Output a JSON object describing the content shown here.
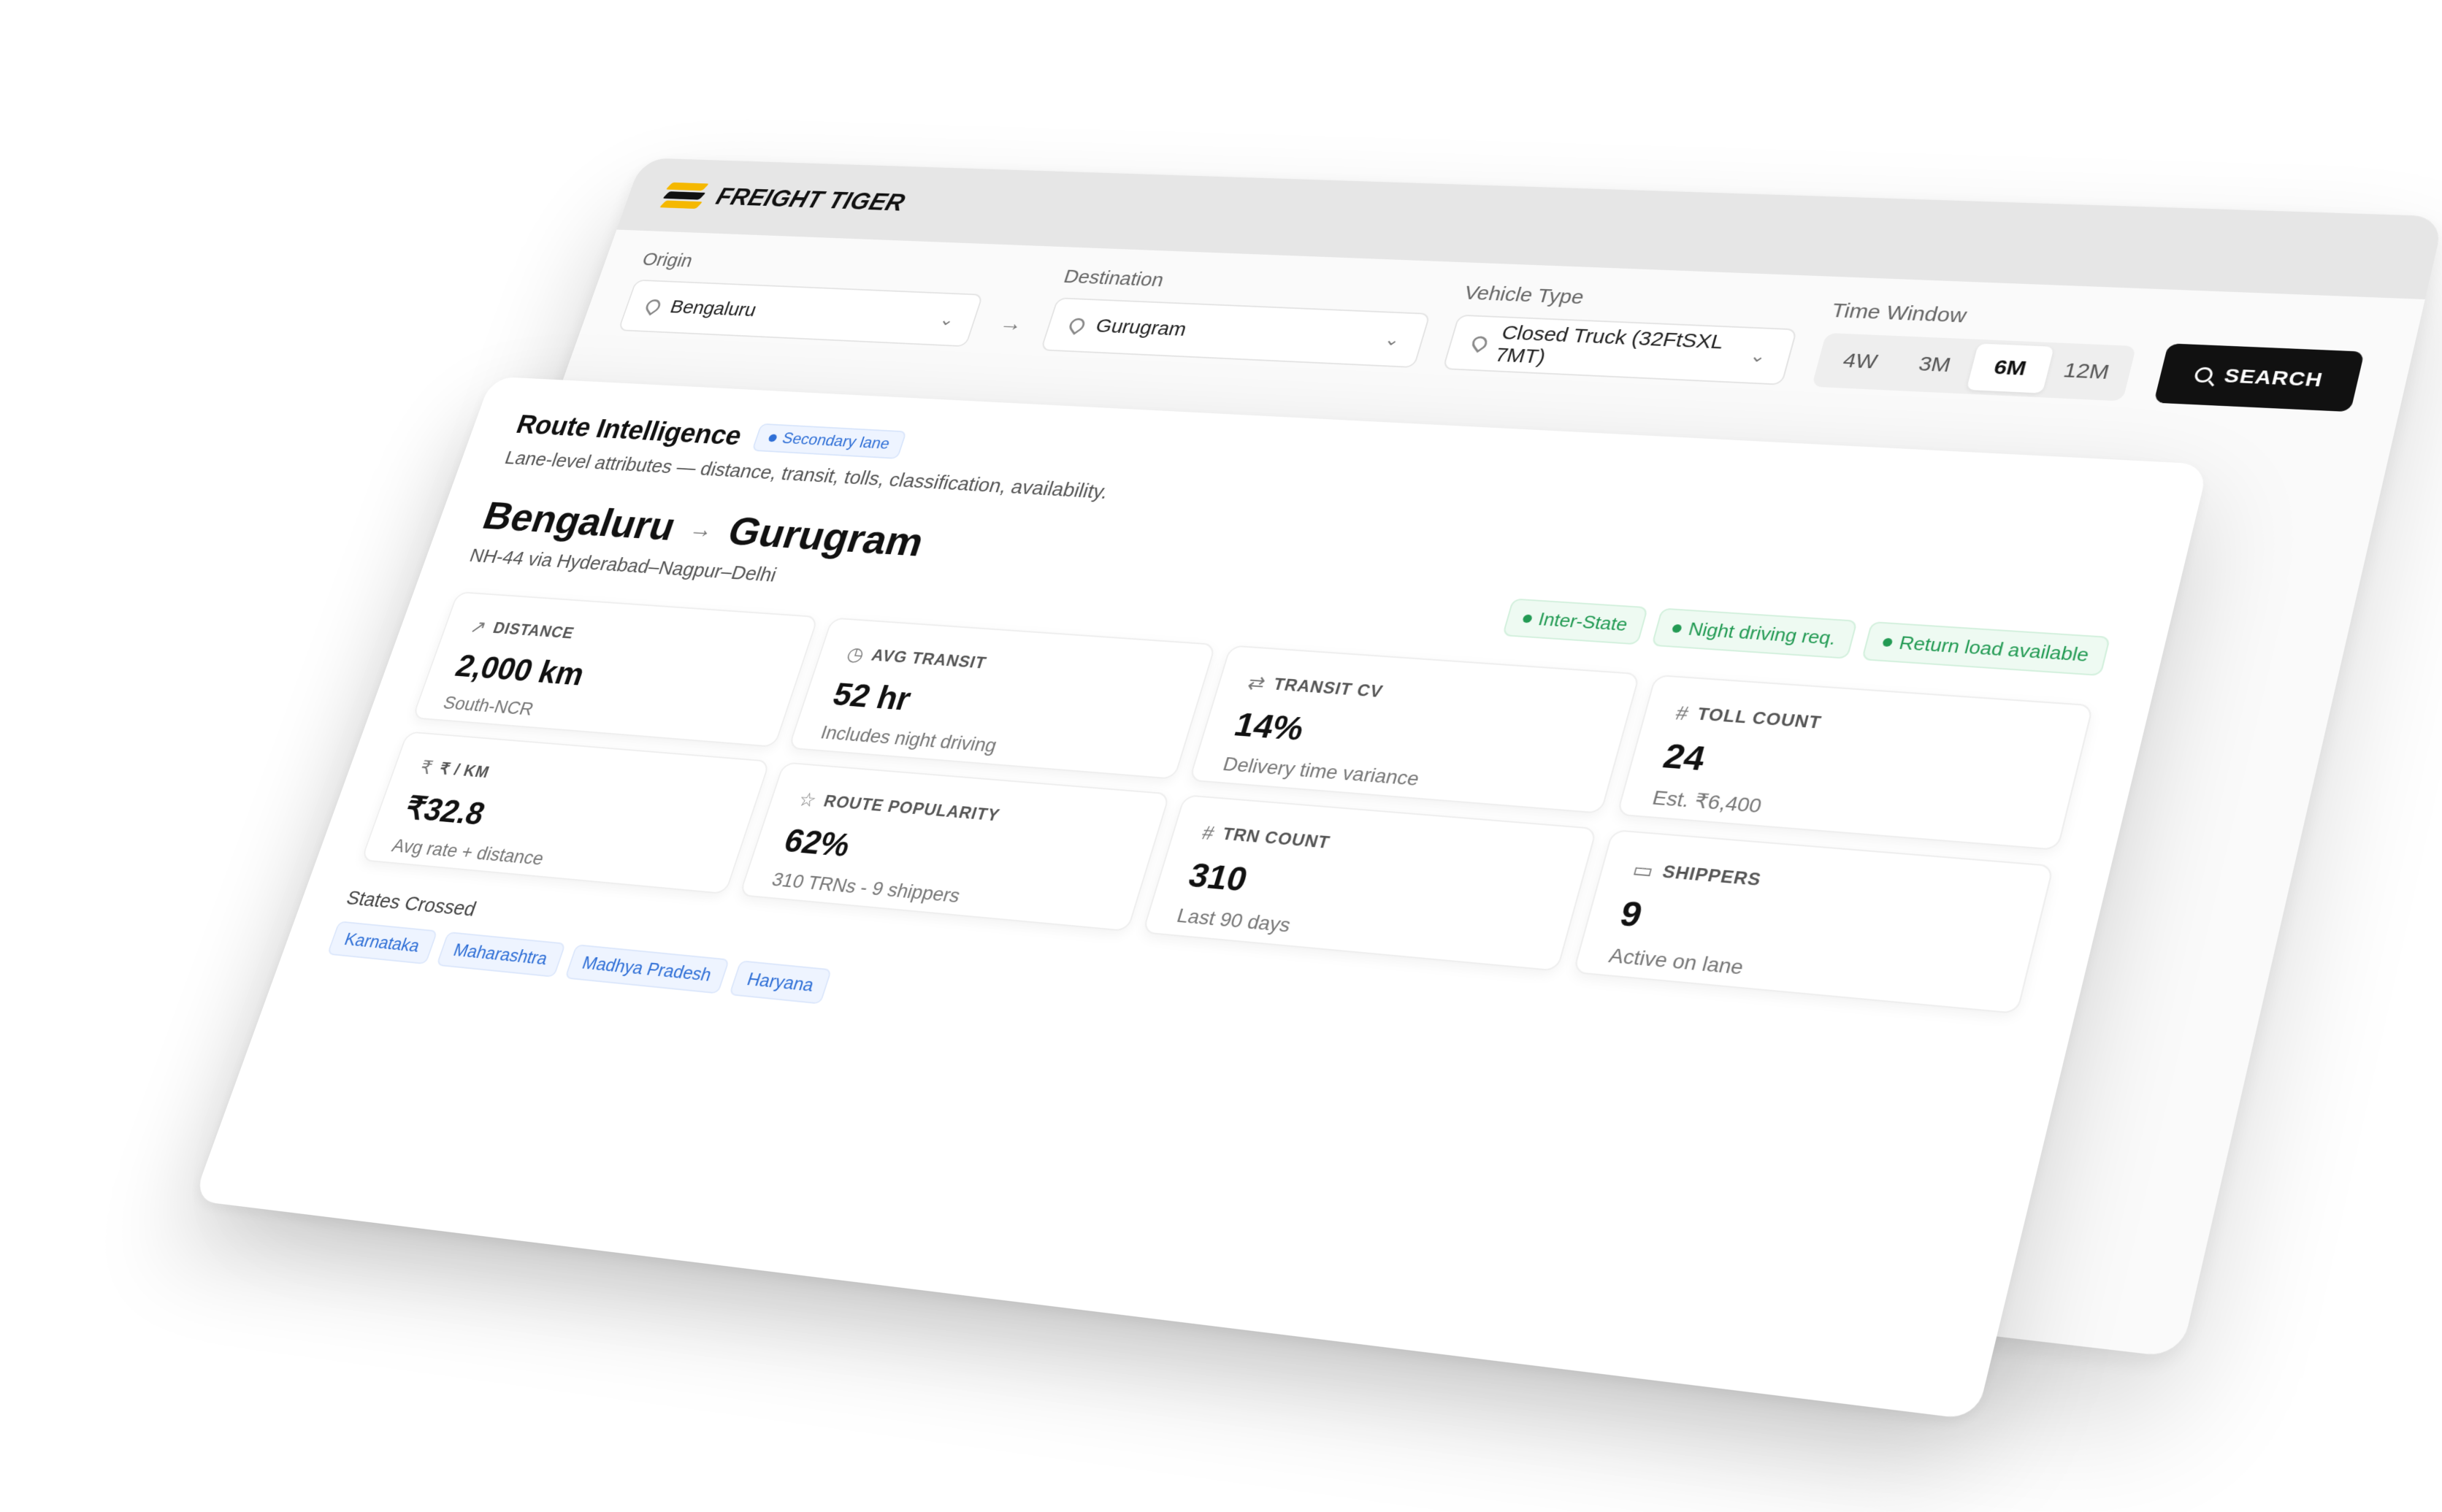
{
  "brand": {
    "name": "FREIGHT TIGER"
  },
  "filters": {
    "origin_label": "Origin",
    "origin_value": "Bengaluru",
    "destination_label": "Destination",
    "destination_value": "Gurugram",
    "vehicle_label": "Vehicle Type",
    "vehicle_value": "Closed Truck (32FtSXL 7MT)",
    "time_label": "Time Window",
    "time_options": [
      "4W",
      "3M",
      "6M",
      "12M"
    ],
    "time_selected": "6M",
    "search_label": "SEARCH"
  },
  "route_intel": {
    "title": "Route Intelligence",
    "badge": "Secondary lane",
    "subtitle": "Lane-level attributes — distance, transit, tolls, classification, availability.",
    "origin": "Bengaluru",
    "destination": "Gurugram",
    "via": "NH-44 via Hyderabad–Nagpur–Delhi",
    "tags": [
      "Inter-State",
      "Night driving req.",
      "Return load available"
    ],
    "metrics": [
      {
        "label": "DISTANCE",
        "icon": "↗",
        "value": "2,000 km",
        "sub": "South-NCR"
      },
      {
        "label": "AVG TRANSIT",
        "icon": "◷",
        "value": "52 hr",
        "sub": "Includes night driving"
      },
      {
        "label": "TRANSIT CV",
        "icon": "⇄",
        "value": "14%",
        "sub": "Delivery time variance"
      },
      {
        "label": "TOLL COUNT",
        "icon": "#",
        "value": "24",
        "sub": "Est. ₹6,400"
      },
      {
        "label": "₹ / KM",
        "icon": "₹",
        "value": "₹32.8",
        "sub": "Avg rate + distance"
      },
      {
        "label": "ROUTE POPULARITY",
        "icon": "☆",
        "value": "62%",
        "sub": "310 TRNs - 9 shippers"
      },
      {
        "label": "TRN COUNT",
        "icon": "#",
        "value": "310",
        "sub": "Last 90 days"
      },
      {
        "label": "SHIPPERS",
        "icon": "▭",
        "value": "9",
        "sub": "Active on lane"
      }
    ],
    "states_title": "States Crossed",
    "states": [
      "Karnataka",
      "Maharashtra",
      "Madhya Pradesh",
      "Haryana"
    ]
  },
  "colors": {
    "accent": "#f5b800",
    "tag_green": "#229a53",
    "tag_blue": "#2f6fd6",
    "button": "#111111"
  }
}
